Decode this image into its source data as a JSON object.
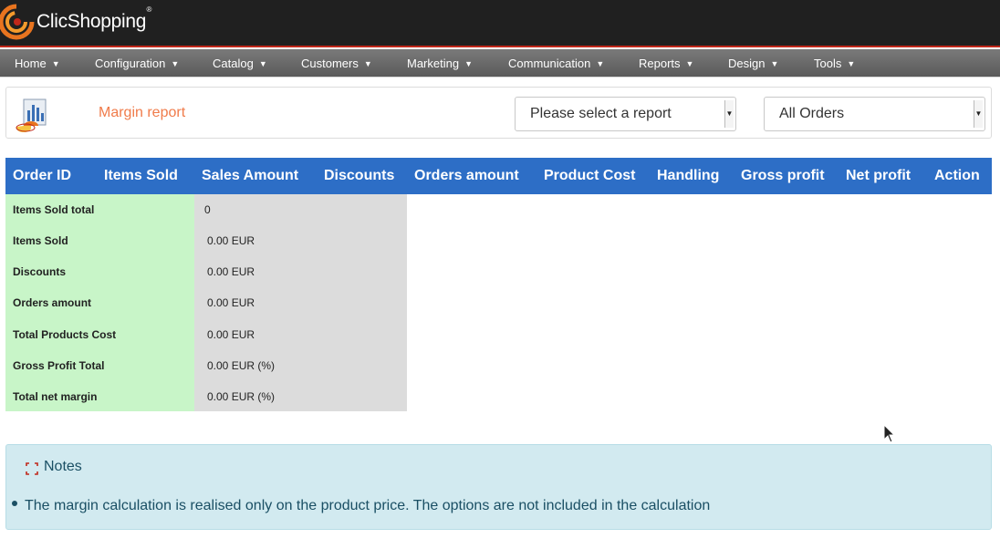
{
  "header": {
    "brand": "ClicShopping",
    "registered_mark": "®"
  },
  "nav": {
    "items": [
      {
        "label": "Home"
      },
      {
        "label": "Configuration"
      },
      {
        "label": "Catalog"
      },
      {
        "label": "Customers"
      },
      {
        "label": "Marketing"
      },
      {
        "label": "Communication"
      },
      {
        "label": "Reports"
      },
      {
        "label": "Design"
      },
      {
        "label": "Tools"
      }
    ],
    "caret": "▼"
  },
  "page": {
    "title": "Margin report",
    "report_select": {
      "value": "Please select a report"
    },
    "orders_select": {
      "value": "All Orders"
    }
  },
  "table": {
    "columns": [
      "Order ID",
      "Items Sold",
      "Sales Amount",
      "Discounts",
      "Orders amount",
      "Product Cost",
      "Handling",
      "Gross profit",
      "Net profit",
      "Action"
    ]
  },
  "summary": {
    "rows": [
      {
        "label": "Items Sold total",
        "value": "0"
      },
      {
        "label": "Items Sold",
        "value": "0.00 EUR"
      },
      {
        "label": "Discounts",
        "value": "0.00 EUR"
      },
      {
        "label": "Orders amount",
        "value": "0.00 EUR"
      },
      {
        "label": "Total Products Cost",
        "value": "0.00 EUR"
      },
      {
        "label": "Gross Profit Total",
        "value": "0.00 EUR (%)"
      },
      {
        "label": "Total net margin",
        "value": "0.00 EUR (%)"
      }
    ]
  },
  "notes": {
    "title": "Notes",
    "items": [
      "The margin calculation is realised only on the product price. The options are not included in the calculation"
    ]
  },
  "colors": {
    "header_bg": "#202020",
    "header_accent": "#c0271a",
    "table_header": "#2d6ec6",
    "title_accent": "#f07b4a",
    "summary_label_bg": "#c8f5c8",
    "summary_value_bg": "#dcdcdc",
    "notes_bg": "#d2eaf0"
  },
  "icons": {
    "logo": "clicshopping-logo-icon",
    "report": "report-chart-icon",
    "notes": "notes-icon",
    "select_arrow": "caret-down-icon"
  }
}
